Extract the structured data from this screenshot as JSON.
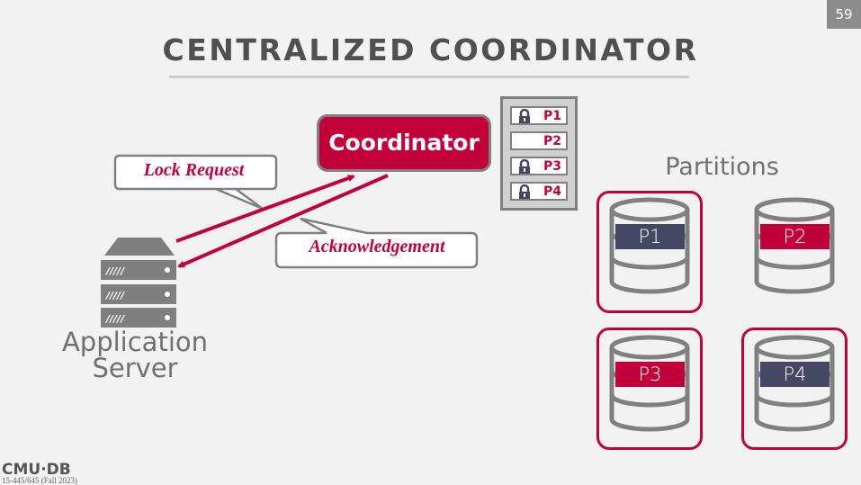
{
  "slide": {
    "number": "59",
    "title": "CENTRALIZED COORDINATOR"
  },
  "coordinator": {
    "label": "Coordinator"
  },
  "lock_table": {
    "rows": [
      {
        "partition": "P1",
        "locked": true
      },
      {
        "partition": "P2",
        "locked": false
      },
      {
        "partition": "P3",
        "locked": true
      },
      {
        "partition": "P4",
        "locked": true
      }
    ]
  },
  "callouts": {
    "lock_request": "Lock Request",
    "acknowledgement": "Acknowledgement"
  },
  "app_server": {
    "label_line1": "Application",
    "label_line2": "Server",
    "icon": "server-rack-icon"
  },
  "partitions": {
    "label": "Partitions",
    "items": [
      {
        "name": "P1",
        "color": "#464665",
        "highlighted": true
      },
      {
        "name": "P2",
        "color": "#c1003b",
        "highlighted": false
      },
      {
        "name": "P3",
        "color": "#c1003b",
        "highlighted": true
      },
      {
        "name": "P4",
        "color": "#464665",
        "highlighted": true
      }
    ]
  },
  "colors": {
    "accent": "#c1003b",
    "navy": "#464665",
    "gray": "#808080"
  },
  "footer": {
    "logo": "CMU·DB",
    "course": "15-445/645 (Fall 2023)"
  }
}
